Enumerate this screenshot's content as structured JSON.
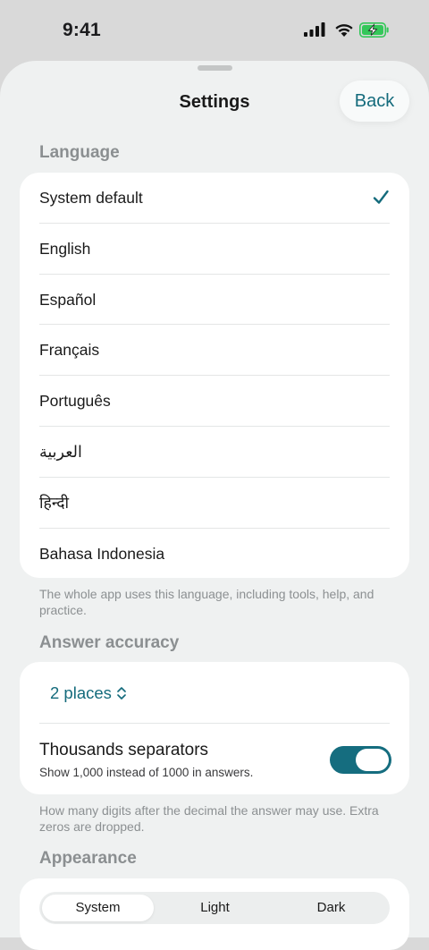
{
  "status_bar": {
    "time": "9:41"
  },
  "nav": {
    "title": "Settings",
    "back_label": "Back"
  },
  "language": {
    "section_title": "Language",
    "selected": "System default",
    "options": [
      "System default",
      "English",
      "Español",
      "Français",
      "Português",
      "العربية",
      "हिन्दी",
      "Bahasa Indonesia"
    ],
    "footnote": "The whole app uses this language, including tools, help, and practice."
  },
  "accuracy": {
    "section_title": "Answer accuracy",
    "places_value": "2 places",
    "separators_title": "Thousands separators",
    "separators_subtitle": "Show 1,000 instead of 1000 in answers.",
    "separators_enabled": true,
    "footnote": "How many digits after the decimal the answer may use. Extra zeros are dropped."
  },
  "appearance": {
    "section_title": "Appearance",
    "options": [
      "System",
      "Light",
      "Dark"
    ],
    "selected": "System"
  },
  "colors": {
    "accent": "#146b7c",
    "toggle_on": "#156d7f",
    "battery": "#34c759"
  }
}
